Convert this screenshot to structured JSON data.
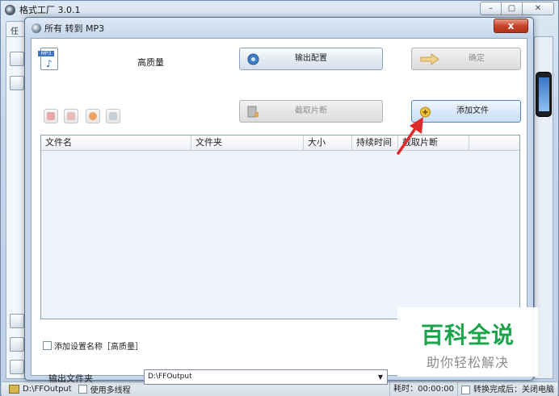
{
  "app": {
    "title": "格式工厂 3.0.1",
    "bg_tab": "任"
  },
  "dialog": {
    "title": "所有 转到 MP3",
    "close_label": "x",
    "quality_label": "高质量",
    "output_config_label": "输出配置",
    "confirm_label": "确定",
    "cut_segment_label": "截取片断",
    "add_file_label": "添加文件",
    "columns": [
      "文件名",
      "文件夹",
      "大小",
      "持续时间",
      "截取片断",
      ""
    ],
    "add_setting_label": "添加设置名称［高质量］",
    "output_folder_label": "输出文件夹",
    "output_folder_value": "D:\\FFOutput"
  },
  "statusbar": {
    "path": "D:\\FFOutput",
    "multithread_label": "使用多线程",
    "elapsed": "耗时：00:00:00",
    "shutdown_label": "转换完成后：关闭电脑"
  },
  "watermark": {
    "line1": "百科全说",
    "line2": "助你轻松解决"
  },
  "colors": {
    "accent_blue": "#3b73c7",
    "arrow_red": "#e02a2a",
    "watermark_green": "#1aa54a",
    "close_red": "#c7442b"
  }
}
